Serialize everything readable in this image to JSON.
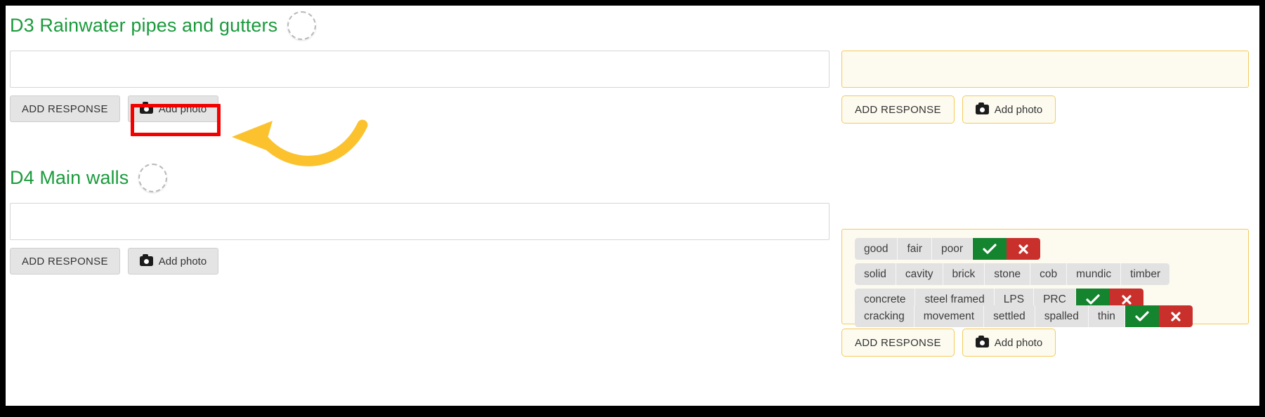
{
  "theme": {
    "heading_green": "#1a9b3c",
    "amber_border": "#f3ca5a",
    "amber_fill": "#fdfbf0",
    "annotation_red": "#f40000",
    "annotation_yellow": "#fbc22e",
    "tag_grey": "#e2e2e2",
    "confirm_green": "#14842f",
    "reject_red": "#c9302c"
  },
  "sections": [
    {
      "id": "d3",
      "heading": "D3 Rainwater pipes and gutters",
      "status_icon": "empty-dashed-circle-icon",
      "response_field_value": "",
      "buttons": {
        "add_response": "ADD RESPONSE",
        "add_photo": "Add photo",
        "add_photo_icon": "camera-icon"
      }
    },
    {
      "id": "d4",
      "heading": "D4 Main walls",
      "status_icon": "empty-dashed-circle-icon",
      "response_field_value": "",
      "buttons": {
        "add_response": "ADD RESPONSE",
        "add_photo": "Add photo",
        "add_photo_icon": "camera-icon"
      }
    }
  ],
  "right_panel_top": {
    "field_value": "",
    "buttons": {
      "add_response": "ADD RESPONSE",
      "add_photo": "Add photo",
      "add_photo_icon": "camera-icon"
    }
  },
  "right_panel_bottom": {
    "tag_rows": [
      {
        "id": "condition",
        "tags": [
          "good",
          "fair",
          "poor"
        ],
        "confirm_icon": "check-icon",
        "reject_icon": "cross-icon"
      },
      {
        "id": "construction-a",
        "tags": [
          "solid",
          "cavity",
          "brick",
          "stone",
          "cob",
          "mundic",
          "timber"
        ],
        "confirm_icon": null,
        "reject_icon": null
      },
      {
        "id": "construction-b",
        "tags": [
          "concrete",
          "steel framed",
          "LPS",
          "PRC"
        ],
        "confirm_icon": "check-icon",
        "reject_icon": "cross-icon"
      },
      {
        "id": "defects",
        "tags": [
          "cracking",
          "movement",
          "settled",
          "spalled",
          "thin"
        ],
        "confirm_icon": "check-icon",
        "reject_icon": "cross-icon"
      }
    ],
    "buttons": {
      "add_response": "ADD RESPONSE",
      "add_photo": "Add photo",
      "add_photo_icon": "camera-icon"
    }
  },
  "annotations": {
    "highlight_target": "add-photo-button-d3",
    "highlight_shape": "red-rectangle-outline",
    "pointer_shape": "curved-yellow-arrow",
    "pointer_direction": "left"
  }
}
